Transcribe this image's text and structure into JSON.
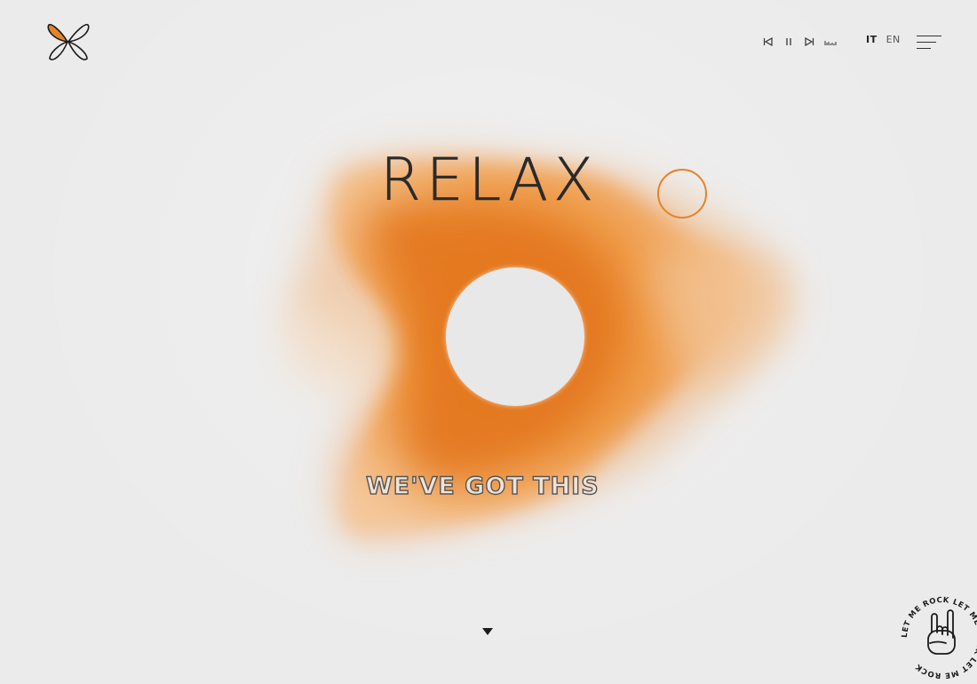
{
  "brand": {
    "logo": "butterfly-logo-icon",
    "accent": "#e5832b"
  },
  "player": {
    "controls": [
      "previous-icon",
      "pause-icon",
      "next-icon",
      "equalizer-icon"
    ]
  },
  "language": {
    "current": "IT",
    "alternate": "EN"
  },
  "menu": {
    "icon": "hamburger-menu-icon"
  },
  "hero": {
    "title": "RELAX",
    "tagline": "WE'VE GOT THIS",
    "blob_color": "#e5832b"
  },
  "scroll": {
    "icon": "scroll-down-icon"
  },
  "badge": {
    "text": "LET ME ROCK LET ME ROCK LET ME ROCK",
    "icon": "rock-hand-icon"
  }
}
